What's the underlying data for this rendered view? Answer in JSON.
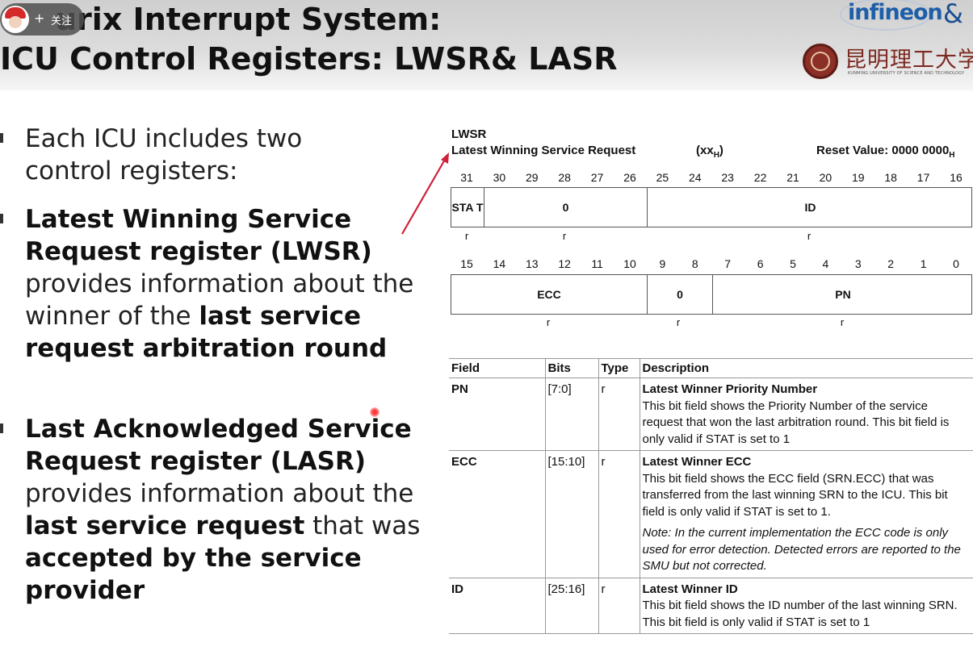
{
  "header": {
    "title_line1": "urix Interrupt System:",
    "title_line2": "ICU Control Registers: LWSR& LASR",
    "follow_plus": "+",
    "follow_label": "关注",
    "logo_infineon": "infineon",
    "logo_amp": "&",
    "logo_kmust_cn": "昆明理工大学",
    "logo_kmust_en": "KUNMING UNIVERSITY OF SCIENCE AND TECHNOLOGY"
  },
  "left": {
    "p1": [
      "Each ICU includes two",
      "control registers:"
    ],
    "lwsr": {
      "bold_lines": [
        "Latest Winning Service",
        "Request register (LWSR)"
      ],
      "line3": "provides information about the",
      "line4_pre": "winner of the ",
      "line4_bold": "last service",
      "line5_bold": "request arbitration round"
    },
    "lasr": {
      "bold_lines": [
        "Last Acknowledged Service",
        "Request register (LASR)"
      ],
      "line3": "provides information about the",
      "line4_bold": "last service request",
      "line4_post": " that was",
      "line5_bold": "accepted by the service",
      "line6_bold": "provider"
    }
  },
  "register": {
    "name": "LWSR",
    "long_name": "Latest Winning Service Request",
    "offset": "(xx",
    "offset_sub": "H",
    "offset_close": ")",
    "reset_label": "Reset Value: 0000 0000",
    "reset_sub": "H",
    "upper_bits": [
      "31",
      "30",
      "29",
      "28",
      "27",
      "26",
      "25",
      "24",
      "23",
      "22",
      "21",
      "20",
      "19",
      "18",
      "17",
      "16"
    ],
    "lower_bits": [
      "15",
      "14",
      "13",
      "12",
      "11",
      "10",
      "9",
      "8",
      "7",
      "6",
      "5",
      "4",
      "3",
      "2",
      "1",
      "0"
    ],
    "upper_fields": [
      {
        "label": "STA T",
        "access": "r"
      },
      {
        "label": "0",
        "access": "r"
      },
      {
        "label": "ID",
        "access": "r"
      }
    ],
    "lower_fields": [
      {
        "label": "ECC",
        "access": "r"
      },
      {
        "label": "0",
        "access": "r"
      },
      {
        "label": "PN",
        "access": "r"
      }
    ]
  },
  "field_table": {
    "headers": [
      "Field",
      "Bits",
      "Type",
      "Description"
    ],
    "rows": [
      {
        "field": "PN",
        "bits": "[7:0]",
        "type": "r",
        "title": "Latest Winner Priority Number",
        "desc": "This bit field shows the Priority Number of the service request that won the last arbitration round. This bit field is only valid if STAT is set to 1"
      },
      {
        "field": "ECC",
        "bits": "[15:10]",
        "type": "r",
        "title": "Latest Winner ECC",
        "desc": "This bit field shows the ECC field (SRN.ECC) that was transferred from the last winning SRN to the ICU. This bit field is only valid if STAT is set to 1.",
        "note_label": "Note:",
        "note": "In the current implementation the ECC code is only used for error detection. Detected errors are reported to the SMU but not corrected."
      },
      {
        "field": "ID",
        "bits": "[25:16]",
        "type": "r",
        "title": "Latest Winner ID",
        "desc": "This bit field shows the ID number of the last winning SRN. This bit field is only valid if STAT is set to 1"
      }
    ]
  },
  "colors": {
    "arrow": "#d0203a",
    "laser": "#ff3a3a",
    "infineon_blue": "#1d5fa8",
    "kmust_red": "#7d2a22"
  }
}
